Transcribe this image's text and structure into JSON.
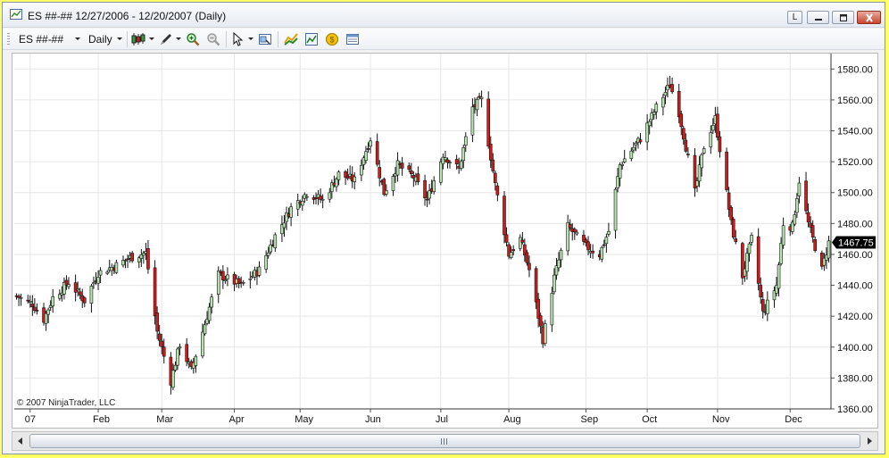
{
  "window": {
    "title": "ES ##-##  12/27/2006 - 12/20/2007 (Daily)",
    "btn_l": "L"
  },
  "toolbar": {
    "instrument": "ES ##-##",
    "interval": "Daily",
    "icons": [
      "candlestick-style-icon",
      "drawing-pen-icon",
      "zoom-in-icon",
      "zoom-out-icon",
      "cursor-pointer-icon",
      "data-box-icon",
      "indicators-icon",
      "strategies-icon",
      "market-analyzer-icon",
      "properties-icon"
    ]
  },
  "chart": {
    "copyright": "© 2007 NinjaTrader, LLC",
    "colors": {
      "up": "#b7e4b0",
      "down": "#d21a1a",
      "price_marker": "#000000"
    }
  },
  "chart_data": {
    "type": "candlestick",
    "ylim": [
      1360,
      1590
    ],
    "y_ticks": [
      "1360.00",
      "1380.00",
      "1400.00",
      "1420.00",
      "1440.00",
      "1460.00",
      "1480.00",
      "1500.00",
      "1520.00",
      "1540.00",
      "1560.00",
      "1580.00"
    ],
    "x_ticks": [
      {
        "label": "07",
        "date": "2007-01-02"
      },
      {
        "label": "Feb",
        "date": "2007-02-01"
      },
      {
        "label": "Mar",
        "date": "2007-03-01"
      },
      {
        "label": "Apr",
        "date": "2007-04-02"
      },
      {
        "label": "May",
        "date": "2007-05-01"
      },
      {
        "label": "Jun",
        "date": "2007-06-01"
      },
      {
        "label": "Jul",
        "date": "2007-07-02"
      },
      {
        "label": "Aug",
        "date": "2007-08-01"
      },
      {
        "label": "Sep",
        "date": "2007-09-04"
      },
      {
        "label": "Oct",
        "date": "2007-10-01"
      },
      {
        "label": "Nov",
        "date": "2007-11-01"
      },
      {
        "label": "Dec",
        "date": "2007-12-03"
      }
    ],
    "last_price": "1467.75",
    "grid": true,
    "close_path": [
      [
        "2006-12-27",
        1433
      ],
      [
        "2007-01-03",
        1428
      ],
      [
        "2007-01-08",
        1418
      ],
      [
        "2007-01-12",
        1432
      ],
      [
        "2007-01-19",
        1442
      ],
      [
        "2007-01-26",
        1430
      ],
      [
        "2007-02-01",
        1448
      ],
      [
        "2007-02-09",
        1453
      ],
      [
        "2007-02-15",
        1458
      ],
      [
        "2007-02-22",
        1461
      ],
      [
        "2007-02-27",
        1410
      ],
      [
        "2007-03-05",
        1378
      ],
      [
        "2007-03-09",
        1402
      ],
      [
        "2007-03-14",
        1385
      ],
      [
        "2007-03-20",
        1415
      ],
      [
        "2007-03-26",
        1447
      ],
      [
        "2007-04-05",
        1440
      ],
      [
        "2007-04-13",
        1450
      ],
      [
        "2007-04-20",
        1472
      ],
      [
        "2007-04-27",
        1490
      ],
      [
        "2007-05-04",
        1500
      ],
      [
        "2007-05-11",
        1495
      ],
      [
        "2007-05-18",
        1512
      ],
      [
        "2007-05-25",
        1508
      ],
      [
        "2007-06-01",
        1535
      ],
      [
        "2007-06-07",
        1500
      ],
      [
        "2007-06-13",
        1518
      ],
      [
        "2007-06-20",
        1510
      ],
      [
        "2007-06-26",
        1495
      ],
      [
        "2007-07-03",
        1525
      ],
      [
        "2007-07-10",
        1515
      ],
      [
        "2007-07-16",
        1555
      ],
      [
        "2007-07-20",
        1560
      ],
      [
        "2007-07-26",
        1505
      ],
      [
        "2007-08-01",
        1460
      ],
      [
        "2007-08-06",
        1470
      ],
      [
        "2007-08-10",
        1450
      ],
      [
        "2007-08-16",
        1405
      ],
      [
        "2007-08-21",
        1445
      ],
      [
        "2007-08-27",
        1478
      ],
      [
        "2007-09-04",
        1465
      ],
      [
        "2007-09-10",
        1460
      ],
      [
        "2007-09-14",
        1475
      ],
      [
        "2007-09-19",
        1518
      ],
      [
        "2007-09-28",
        1535
      ],
      [
        "2007-10-05",
        1555
      ],
      [
        "2007-10-11",
        1570
      ],
      [
        "2007-10-15",
        1552
      ],
      [
        "2007-10-22",
        1500
      ],
      [
        "2007-10-26",
        1530
      ],
      [
        "2007-10-31",
        1548
      ],
      [
        "2007-11-07",
        1480
      ],
      [
        "2007-11-12",
        1446
      ],
      [
        "2007-11-16",
        1470
      ],
      [
        "2007-11-21",
        1422
      ],
      [
        "2007-11-27",
        1440
      ],
      [
        "2007-11-30",
        1480
      ],
      [
        "2007-12-04",
        1478
      ],
      [
        "2007-12-07",
        1508
      ],
      [
        "2007-12-11",
        1480
      ],
      [
        "2007-12-17",
        1450
      ],
      [
        "2007-12-20",
        1467.75
      ]
    ]
  },
  "scrollbar": {
    "grip_label": "III"
  }
}
